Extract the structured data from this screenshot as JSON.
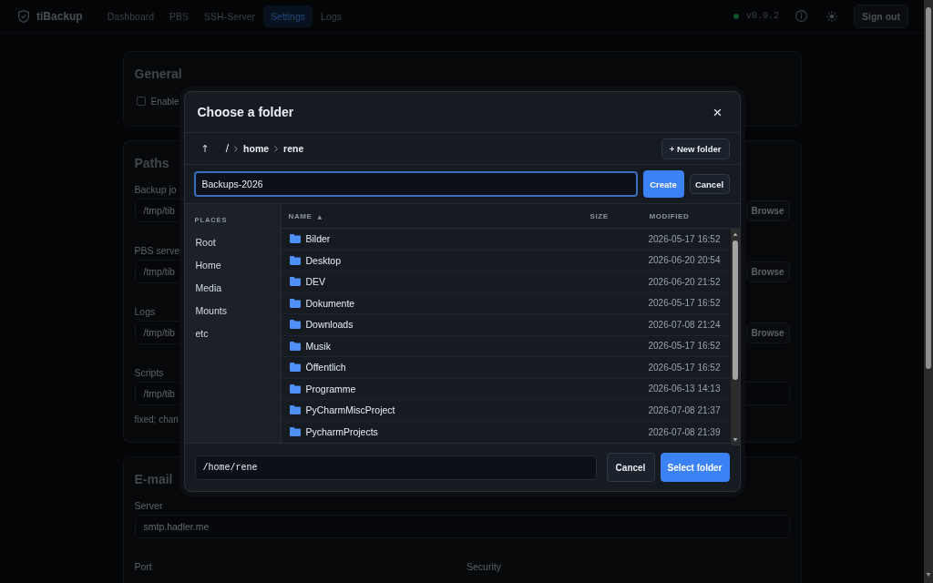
{
  "app": {
    "name": "tiBackup",
    "nav": [
      {
        "label": "Dashboard",
        "selected": false
      },
      {
        "label": "PBS",
        "selected": false
      },
      {
        "label": "SSH-Server",
        "selected": false
      },
      {
        "label": "Settings",
        "selected": true
      },
      {
        "label": "Logs",
        "selected": false
      }
    ],
    "status": {
      "online": true,
      "version": "v0.9.2"
    },
    "sign_out": "Sign out"
  },
  "settings": {
    "sections": [
      {
        "title": "General",
        "fields": [
          {
            "kind": "checkbox",
            "label": "Enable",
            "checked": false
          }
        ]
      },
      {
        "title": "Paths",
        "fields": [
          {
            "kind": "path",
            "label": "Backup jo",
            "value": "/tmp/tib",
            "button": "Browse"
          },
          {
            "kind": "path",
            "label": "PBS serve",
            "value": "/tmp/tib",
            "button": "Browse"
          },
          {
            "kind": "path",
            "label": "Logs",
            "value": "/tmp/tib",
            "button": "Browse"
          },
          {
            "kind": "text",
            "label": "Scripts",
            "value": "/tmp/tib"
          },
          {
            "kind": "hint",
            "text": "fixed; chan"
          }
        ]
      },
      {
        "title": "E-mail",
        "fields": [
          {
            "kind": "text",
            "label": "Server",
            "value": "smtp.hadler.me"
          },
          {
            "kind": "pair",
            "labels": [
              "Port",
              "Security"
            ]
          }
        ]
      }
    ]
  },
  "dialog": {
    "title": "Choose a folder",
    "close": "×",
    "up": "↑",
    "breadcrumb": [
      "/",
      "home",
      "rene"
    ],
    "new_folder_button": "+ New folder",
    "new_folder": {
      "value": "Backups-2026",
      "focused": true,
      "create": "Create",
      "cancel": "Cancel"
    },
    "places": {
      "heading": "PLACES",
      "items": [
        "Root",
        "Home",
        "Media",
        "Mounts",
        "etc"
      ]
    },
    "columns": [
      {
        "label": "NAME",
        "sort_mark": "▲"
      },
      {
        "label": "SIZE"
      },
      {
        "label": "MODIFIED"
      }
    ],
    "rows": [
      {
        "name": "Bilder",
        "modified": "2026-05-17 16:52"
      },
      {
        "name": "Desktop",
        "modified": "2026-06-20 20:54"
      },
      {
        "name": "DEV",
        "modified": "2026-06-20 21:52"
      },
      {
        "name": "Dokumente",
        "modified": "2026-05-17 16:52"
      },
      {
        "name": "Downloads",
        "modified": "2026-07-08 21:24"
      },
      {
        "name": "Musik",
        "modified": "2026-05-17 16:52"
      },
      {
        "name": "Öffentlich",
        "modified": "2026-05-17 16:52"
      },
      {
        "name": "Programme",
        "modified": "2026-06-13 14:13"
      },
      {
        "name": "PyCharmMiscProject",
        "modified": "2026-07-08 21:37"
      },
      {
        "name": "PycharmProjects",
        "modified": "2026-07-08 21:39"
      }
    ],
    "path": "/home/rene",
    "cancel": "Cancel",
    "select": "Select folder"
  }
}
